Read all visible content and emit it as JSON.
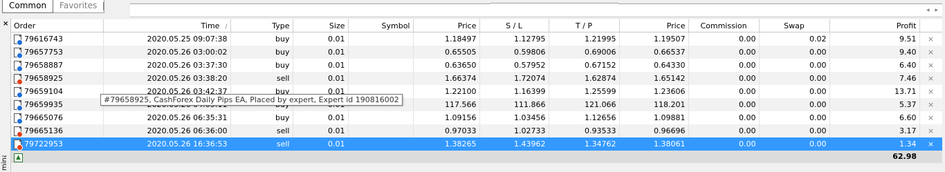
{
  "tabs": [
    {
      "label": "Common",
      "active": true
    },
    {
      "label": "Favorites",
      "active": false
    }
  ],
  "nav": {
    "left": "◂",
    "right": "▸"
  },
  "side": {
    "close": "×",
    "label": "minal"
  },
  "columns": [
    "Order",
    "Time",
    "Type",
    "Size",
    "Symbol",
    "Price",
    "S / L",
    "T / P",
    "Price",
    "Commission",
    "Swap",
    "Profit"
  ],
  "sort_indicator": "/",
  "rows": [
    {
      "order": "79616743",
      "time": "2020.05.25 09:07:38",
      "type": "buy",
      "size": "0.01",
      "symbol": "",
      "price": "1.18497",
      "sl": "1.12795",
      "tp": "1.21995",
      "cur": "1.19507",
      "commission": "0.00",
      "swap": "0.02",
      "profit": "9.51",
      "kind": "buy"
    },
    {
      "order": "79657753",
      "time": "2020.05.26 03:00:02",
      "type": "buy",
      "size": "0.01",
      "symbol": "",
      "price": "0.65505",
      "sl": "0.59806",
      "tp": "0.69006",
      "cur": "0.66537",
      "commission": "0.00",
      "swap": "0.00",
      "profit": "9.40",
      "kind": "buy"
    },
    {
      "order": "79658887",
      "time": "2020.05.26 03:37:30",
      "type": "buy",
      "size": "0.01",
      "symbol": "",
      "price": "0.63650",
      "sl": "0.57952",
      "tp": "0.67152",
      "cur": "0.64330",
      "commission": "0.00",
      "swap": "0.00",
      "profit": "6.40",
      "kind": "buy"
    },
    {
      "order": "79658925",
      "time": "2020.05.26 03:38:20",
      "type": "sell",
      "size": "0.01",
      "symbol": "",
      "price": "1.66374",
      "sl": "1.72074",
      "tp": "1.62874",
      "cur": "1.65142",
      "commission": "0.00",
      "swap": "0.00",
      "profit": "7.46",
      "kind": "sell"
    },
    {
      "order": "79659104",
      "time": "2020.05.26 03:42:37",
      "type": "buy",
      "size": "0.01",
      "symbol": "",
      "price": "1.22100",
      "sl": "1.16399",
      "tp": "1.25599",
      "cur": "1.23606",
      "commission": "0.00",
      "swap": "0.00",
      "profit": "13.71",
      "kind": "buy"
    },
    {
      "order": "79659935",
      "time": "2020.05.26 04:05:11",
      "type": "buy",
      "size": "0.01",
      "symbol": "",
      "price": "117.566",
      "sl": "111.866",
      "tp": "121.066",
      "cur": "118.201",
      "commission": "0.00",
      "swap": "0.00",
      "profit": "5.37",
      "kind": "buy"
    },
    {
      "order": "79665076",
      "time": "2020.05.26 06:35:31",
      "type": "buy",
      "size": "0.01",
      "symbol": "",
      "price": "1.09156",
      "sl": "1.03456",
      "tp": "1.12656",
      "cur": "1.09881",
      "commission": "0.00",
      "swap": "0.00",
      "profit": "6.60",
      "kind": "buy"
    },
    {
      "order": "79665136",
      "time": "2020.05.26 06:36:00",
      "type": "sell",
      "size": "0.01",
      "symbol": "",
      "price": "0.97033",
      "sl": "1.02733",
      "tp": "0.93533",
      "cur": "0.96696",
      "commission": "0.00",
      "swap": "0.00",
      "profit": "3.17",
      "kind": "sell"
    },
    {
      "order": "79722953",
      "time": "2020.05.26 16:36:53",
      "type": "sell",
      "size": "0.01",
      "symbol": "",
      "price": "1.38265",
      "sl": "1.43962",
      "tp": "1.34762",
      "cur": "1.38061",
      "commission": "0.00",
      "swap": "0.00",
      "profit": "1.34",
      "kind": "sell"
    }
  ],
  "close_glyph": "×",
  "selected_index": 8,
  "footer": {
    "total_profit": "62.98"
  },
  "tooltip": "#79658925, CashForex Daily Pips EA, Placed by expert, Expert id 190816002",
  "colors": {
    "buy_dot": "#1e6fd9",
    "sell_dot": "#e0401a",
    "selection": "#3399ff",
    "footer_bg": "#dcdcdc"
  }
}
